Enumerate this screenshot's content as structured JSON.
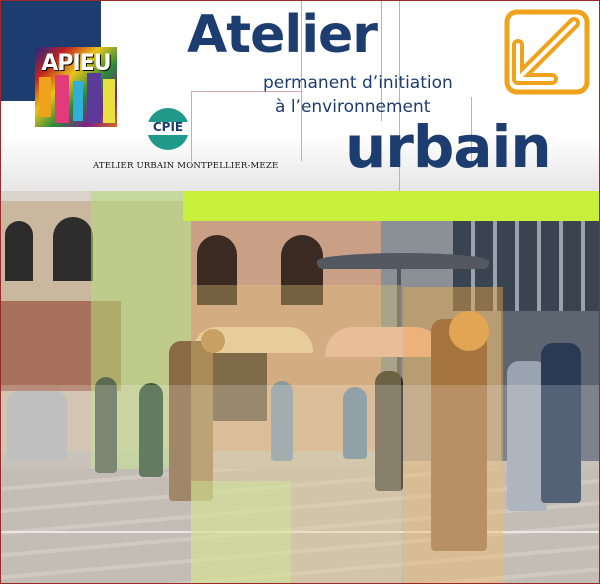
{
  "header": {
    "title_top": "Atelier",
    "title_line1": "permanent d’initiation",
    "title_line2": "à l’environnement",
    "title_bottom": "urbain",
    "organization": "ATELIER URBAIN MONTPELLIER-MEZE",
    "logo_apieu_text": "APIEU",
    "logo_cpie_text": "CPIE"
  },
  "icons": {
    "arrow": "arrow-down-left-icon"
  },
  "colors": {
    "brand_blue": "#1d3d70",
    "accent_orange": "#f0a21c",
    "lime": "#c6f03a"
  },
  "photo": {
    "description_icon": "street-scene-photo"
  }
}
